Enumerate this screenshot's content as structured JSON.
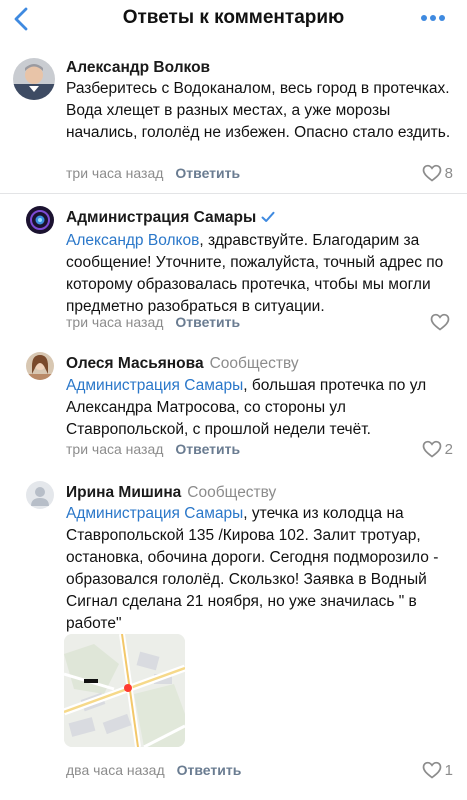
{
  "header": {
    "title": "Ответы к комментарию",
    "back_icon": "chevron-left-icon",
    "more_icon": "more-horizontal-icon",
    "accent": "#3f8ae0"
  },
  "comments": [
    {
      "author": "Александр Волков",
      "tag": "",
      "mention": "",
      "text": "Разберитесь с Водоканалом, весь город в протечках. Вода хлещет в разных местах, а уже морозы начались, гололёд не избежен. Опасно стало ездить.",
      "time": "три часа назад",
      "reply_label": "Ответить",
      "likes": "8"
    },
    {
      "author": "Администрация Самары",
      "verified": true,
      "tag": "",
      "mention": "Александр Волков",
      "text": ", здравствуйте. Благодарим за сообщение! Уточните, пожалуйста, точный адрес по которому образовалась протечка, чтобы мы могли предметно разобраться в ситуации.",
      "time": "три часа назад",
      "reply_label": "Ответить",
      "likes": ""
    },
    {
      "author": "Олеся Масьянова",
      "tag": "Сообществу",
      "mention": "Администрация Самары",
      "text": ", большая протечка по ул Александра Матросова, со стороны ул Ставропольской, с прошлой недели течёт.",
      "time": "три часа назад",
      "reply_label": "Ответить",
      "likes": "2"
    },
    {
      "author": "Ирина Мишина",
      "tag": "Сообществу",
      "mention": "Администрация Самары",
      "text": ", утечка из колодца на Ставропольской 135 /Кирова 102. Залит тротуар, остановка, обочина дороги. Сегодня подморозило - образовался гололёд. Скользко! Заявка в Водный Сигнал сделана 21 ноября, но уже значилась \" в работе\"",
      "time": "два часа назад",
      "reply_label": "Ответить",
      "likes": "1"
    }
  ],
  "colors": {
    "link": "#2a77c9",
    "muted": "#8c8c8c",
    "reply": "#6a7c91",
    "divider": "#e3e4e6"
  }
}
